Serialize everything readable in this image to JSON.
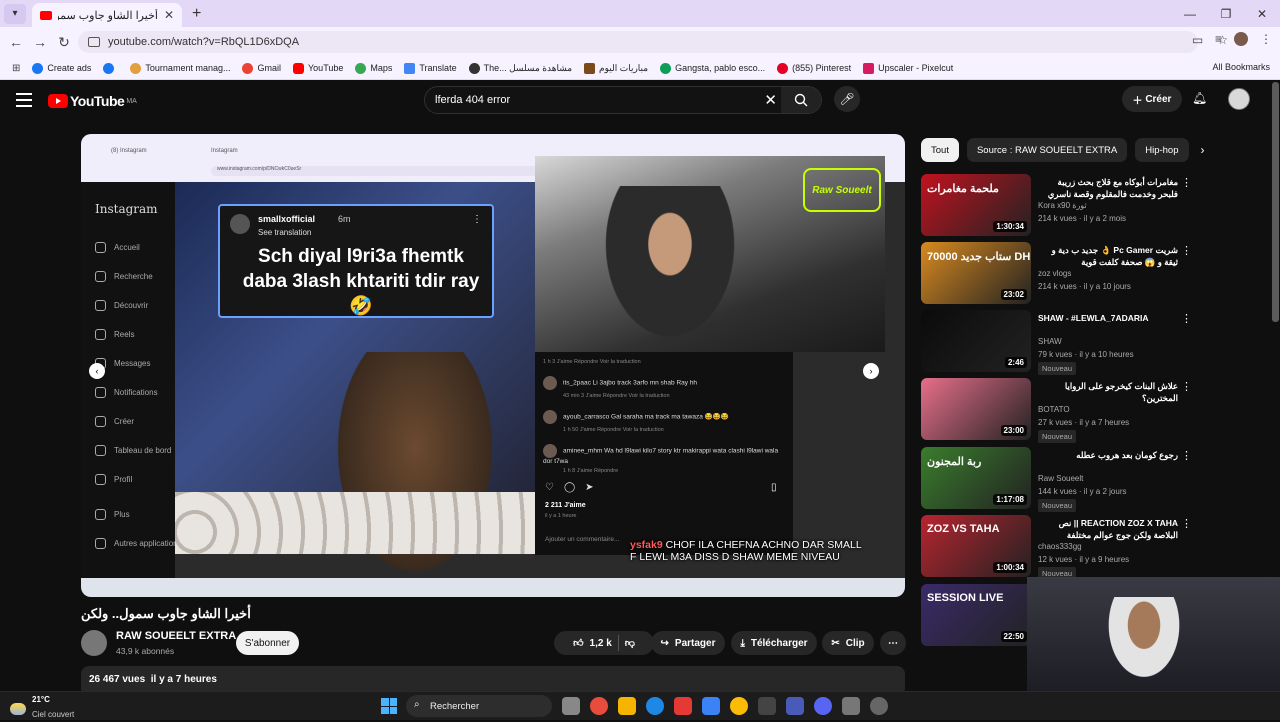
{
  "browser": {
    "tab_title": "أخيرا الشاو جاوب سمول.. ولكن",
    "url": "youtube.com/watch?v=RbQL1D6xDQA",
    "bookmarks": [
      "Create ads",
      "Tournament manag...",
      "Gmail",
      "YouTube",
      "Maps",
      "Translate",
      "The... مشاهدة مسلسل",
      "مباريات اليوم",
      "Gangsta, pablo esco...",
      "(855) Pinterest",
      "Upscaler - Pixelcut"
    ],
    "all_bookmarks": "All Bookmarks"
  },
  "youtube": {
    "logo": "YouTube",
    "logo_region": "MA",
    "search_value": "lferda 404 error",
    "create_label": "Créer"
  },
  "video": {
    "inner_tabs": [
      "(8) Instagram",
      "Instagram"
    ],
    "inner_url": "www.instagram.com/p/DNCwkC0ueSr",
    "sidebar_logo": "Instagram",
    "sidebar_menu": [
      "Accueil",
      "Recherche",
      "Découvrir",
      "Reels",
      "Messages",
      "Notifications",
      "Créer",
      "Tableau de bord",
      "Profil",
      "Plus",
      "Autres applications"
    ],
    "card_user": "smallxofficial",
    "card_time": "6m",
    "card_see": "See translation",
    "card_text": "Sch diyal l9ri3a fhemtk daba 3lash khtariti tdir ray 🤣",
    "cam_logo": "Raw Soueelt",
    "comments": [
      {
        "text": "",
        "meta": "1 h   3 J'aime   Répondre   Voir la traduction"
      },
      {
        "text": "its_2paac Li 3ajbo track 3arfo mn shab Ray hh",
        "meta": "43 min   3 J'aime   Répondre   Voir la traduction"
      },
      {
        "text": "ayoub_carrasco Gal saraha ma track ma tawaza 😂😂😂",
        "meta": "1 h   50 J'aime   Répondre   Voir la traduction"
      },
      {
        "text": "aminee_mhm Wa hd l9lawi kilo7 story ktr makirappi wata clashi l9lawi wala dor t7wa",
        "meta": "1 h   8 J'aime   Répondre"
      }
    ],
    "likes_text": "2 211 J'aime",
    "ago_text": "il y a 1 heure",
    "add_comment": "Ajouter un commentaire...",
    "overlay_user": "ysfak9",
    "overlay_text": "CHOF ILA CHEFNA ACHNO DAR SMALL F LEWL M3A DISS D SHAW MEME NIVEAU"
  },
  "meta": {
    "title": "أخيرا الشاو جاوب سمول.. ولكن",
    "channel": "RAW SOUEELT EXTRA",
    "subs": "43,9 k abonnés",
    "subscribe": "S'abonner",
    "likes": "1,2 k",
    "share": "Partager",
    "download": "Télécharger",
    "clip": "Clip",
    "views": "26 467 vues",
    "date": "il y a 7 heures"
  },
  "chips": [
    "Tout",
    "Source : RAW SOUEELT EXTRA",
    "Hip-hop"
  ],
  "recommendations": [
    {
      "title": "مغامرات أبوكاه مع قلاج بحث زريبة فلبحر وخدمت فالمقلوم وقصة ناسري مع كريمن",
      "channel": "Kora x90 ثورة",
      "meta": "214 k vues · il y a 2 mois",
      "duration": "1:30:34",
      "badge": "",
      "thumb_text": "ملحمة مغامرات",
      "thumb_color": "#c1121f"
    },
    {
      "title": "شريت Pc Gamer 👌 جديد ب دية و ثيقة و 😱 صحفة كلفت قوية",
      "channel": "zoz vlogs",
      "meta": "214 k vues · il y a 10 jours",
      "duration": "23:02",
      "badge": "",
      "thumb_text": "ستاب جديد 70000 DH",
      "thumb_color": "#d98a1f"
    },
    {
      "title": "SHAW - #LEWLA_7ADARIA",
      "channel": "SHAW",
      "meta": "79 k vues · il y a 10 heures",
      "duration": "2:46",
      "badge": "Nouveau",
      "thumb_text": "",
      "thumb_color": "#0b0b0b"
    },
    {
      "title": "علاش البنات كيخرجو على الروايا المخترين؟",
      "channel": "BOTATO",
      "meta": "27 k vues · il y a 7 heures",
      "duration": "23:00",
      "badge": "Nouveau",
      "thumb_text": "",
      "thumb_color": "#e76f8a"
    },
    {
      "title": "رجوع كومان بعد هروب عطله",
      "channel": "Raw Soueelt",
      "meta": "144 k vues · il y a 2 jours",
      "duration": "1:17:08",
      "badge": "Nouveau",
      "thumb_text": "ربة المجنون",
      "thumb_color": "#3a7d2c"
    },
    {
      "title": "REACTION ZOZ X TAHA || نص البلاصة ولكن جوج عوالم مختلفة",
      "channel": "chaos333gg",
      "meta": "12 k vues · il y a 9 heures",
      "duration": "1:00:34",
      "badge": "Nouveau",
      "thumb_text": "ZOZ VS TAHA",
      "thumb_color": "#b8242f"
    },
    {
      "title": "",
      "channel": "",
      "meta": "",
      "duration": "22:50",
      "badge": "",
      "thumb_text": "SESSION LIVE",
      "thumb_color": "#3a2a6a"
    }
  ],
  "taskbar": {
    "temp": "21°C",
    "cond": "Ciel couvert",
    "search": "Rechercher"
  }
}
